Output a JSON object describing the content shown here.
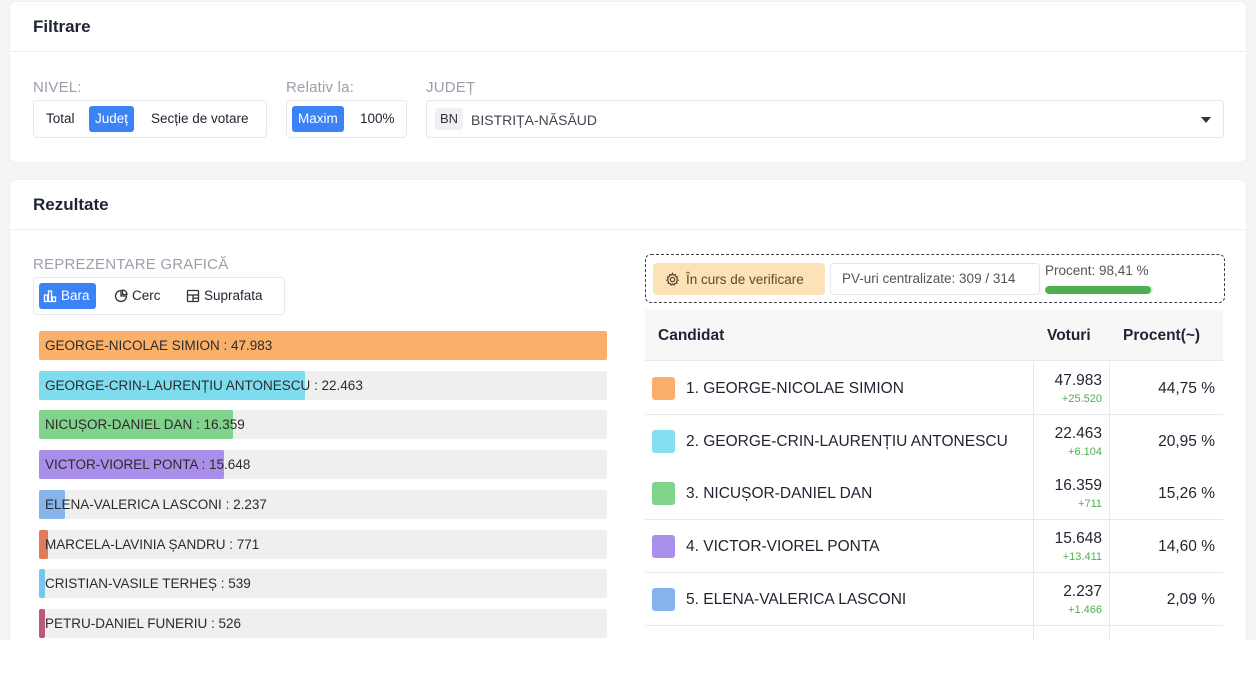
{
  "filter": {
    "title": "Filtrare",
    "nivel_label": "NIVEL:",
    "nivel_options": [
      "Total",
      "Județ",
      "Secție de votare"
    ],
    "nivel_active": 1,
    "relativ_label": "Relativ la:",
    "relativ_options": [
      "Maxim",
      "100%"
    ],
    "relativ_active": 0,
    "judet_label": "JUDEȚ",
    "judet_code": "BN",
    "judet_name": "BISTRIȚA-NĂSĂUD"
  },
  "results": {
    "title": "Rezultate",
    "viz_label": "REPREZENTARE GRAFICĂ",
    "viz_tabs": [
      {
        "label": "Bara",
        "icon": "bar-chart-icon"
      },
      {
        "label": "Cerc",
        "icon": "pie-chart-icon"
      },
      {
        "label": "Suprafata",
        "icon": "treemap-icon"
      }
    ],
    "viz_active": 0,
    "status": {
      "verif_label": "În curs de verificare",
      "pv_label": "PV-uri centralizate: 309 / 314",
      "percent_label": "Procent: 98,41 %",
      "percent_value": 98.41
    },
    "table": {
      "headers": {
        "candidate": "Candidat",
        "votes": "Voturi",
        "percent": "Procent(~)"
      },
      "rows": [
        {
          "name": "1. GEORGE-NICOLAE SIMION",
          "votes": "47.983",
          "delta": "+25.520",
          "percent": "44,75 %",
          "color": "#fbb06a"
        },
        {
          "name": "2. GEORGE-CRIN-LAURENȚIU ANTONESCU",
          "votes": "22.463",
          "delta": "+6.104",
          "percent": "20,95 %",
          "color": "#82e0f0"
        },
        {
          "name": "3. NICUȘOR-DANIEL DAN",
          "votes": "16.359",
          "delta": "+711",
          "percent": "15,26 %",
          "color": "#7fd38a"
        },
        {
          "name": "4. VICTOR-VIOREL PONTA",
          "votes": "15.648",
          "delta": "+13.411",
          "percent": "14,60 %",
          "color": "#a98eea"
        },
        {
          "name": "5. ELENA-VALERICA LASCONI",
          "votes": "2.237",
          "delta": "+1.466",
          "percent": "2,09 %",
          "color": "#86b5ec"
        }
      ]
    }
  },
  "chart_data": {
    "type": "bar",
    "orientation": "horizontal",
    "categories": [
      "GEORGE-NICOLAE SIMION",
      "GEORGE-CRIN-LAURENȚIU ANTONESCU",
      "NICUȘOR-DANIEL DAN",
      "VICTOR-VIOREL PONTA",
      "ELENA-VALERICA LASCONI",
      "MARCELA-LAVINIA ȘANDRU",
      "CRISTIAN-VASILE TERHEȘ",
      "PETRU-DANIEL FUNERIU"
    ],
    "values": [
      47983,
      22463,
      16359,
      15648,
      2237,
      771,
      539,
      526
    ],
    "labels": [
      "GEORGE-NICOLAE SIMION : 47.983",
      "GEORGE-CRIN-LAURENȚIU ANTONESCU : 22.463",
      "NICUȘOR-DANIEL DAN : 16.359",
      "VICTOR-VIOREL PONTA : 15.648",
      "ELENA-VALERICA LASCONI : 2.237",
      "MARCELA-LAVINIA ȘANDRU : 771",
      "CRISTIAN-VASILE TERHEȘ : 539",
      "PETRU-DANIEL FUNERIU : 526"
    ],
    "colors": [
      "#fbb06a",
      "#7edcef",
      "#7fd38a",
      "#a98eea",
      "#86b5ec",
      "#e07b5a",
      "#78c6f0",
      "#c0567a"
    ],
    "xlim": [
      0,
      47983
    ],
    "grid": false
  }
}
